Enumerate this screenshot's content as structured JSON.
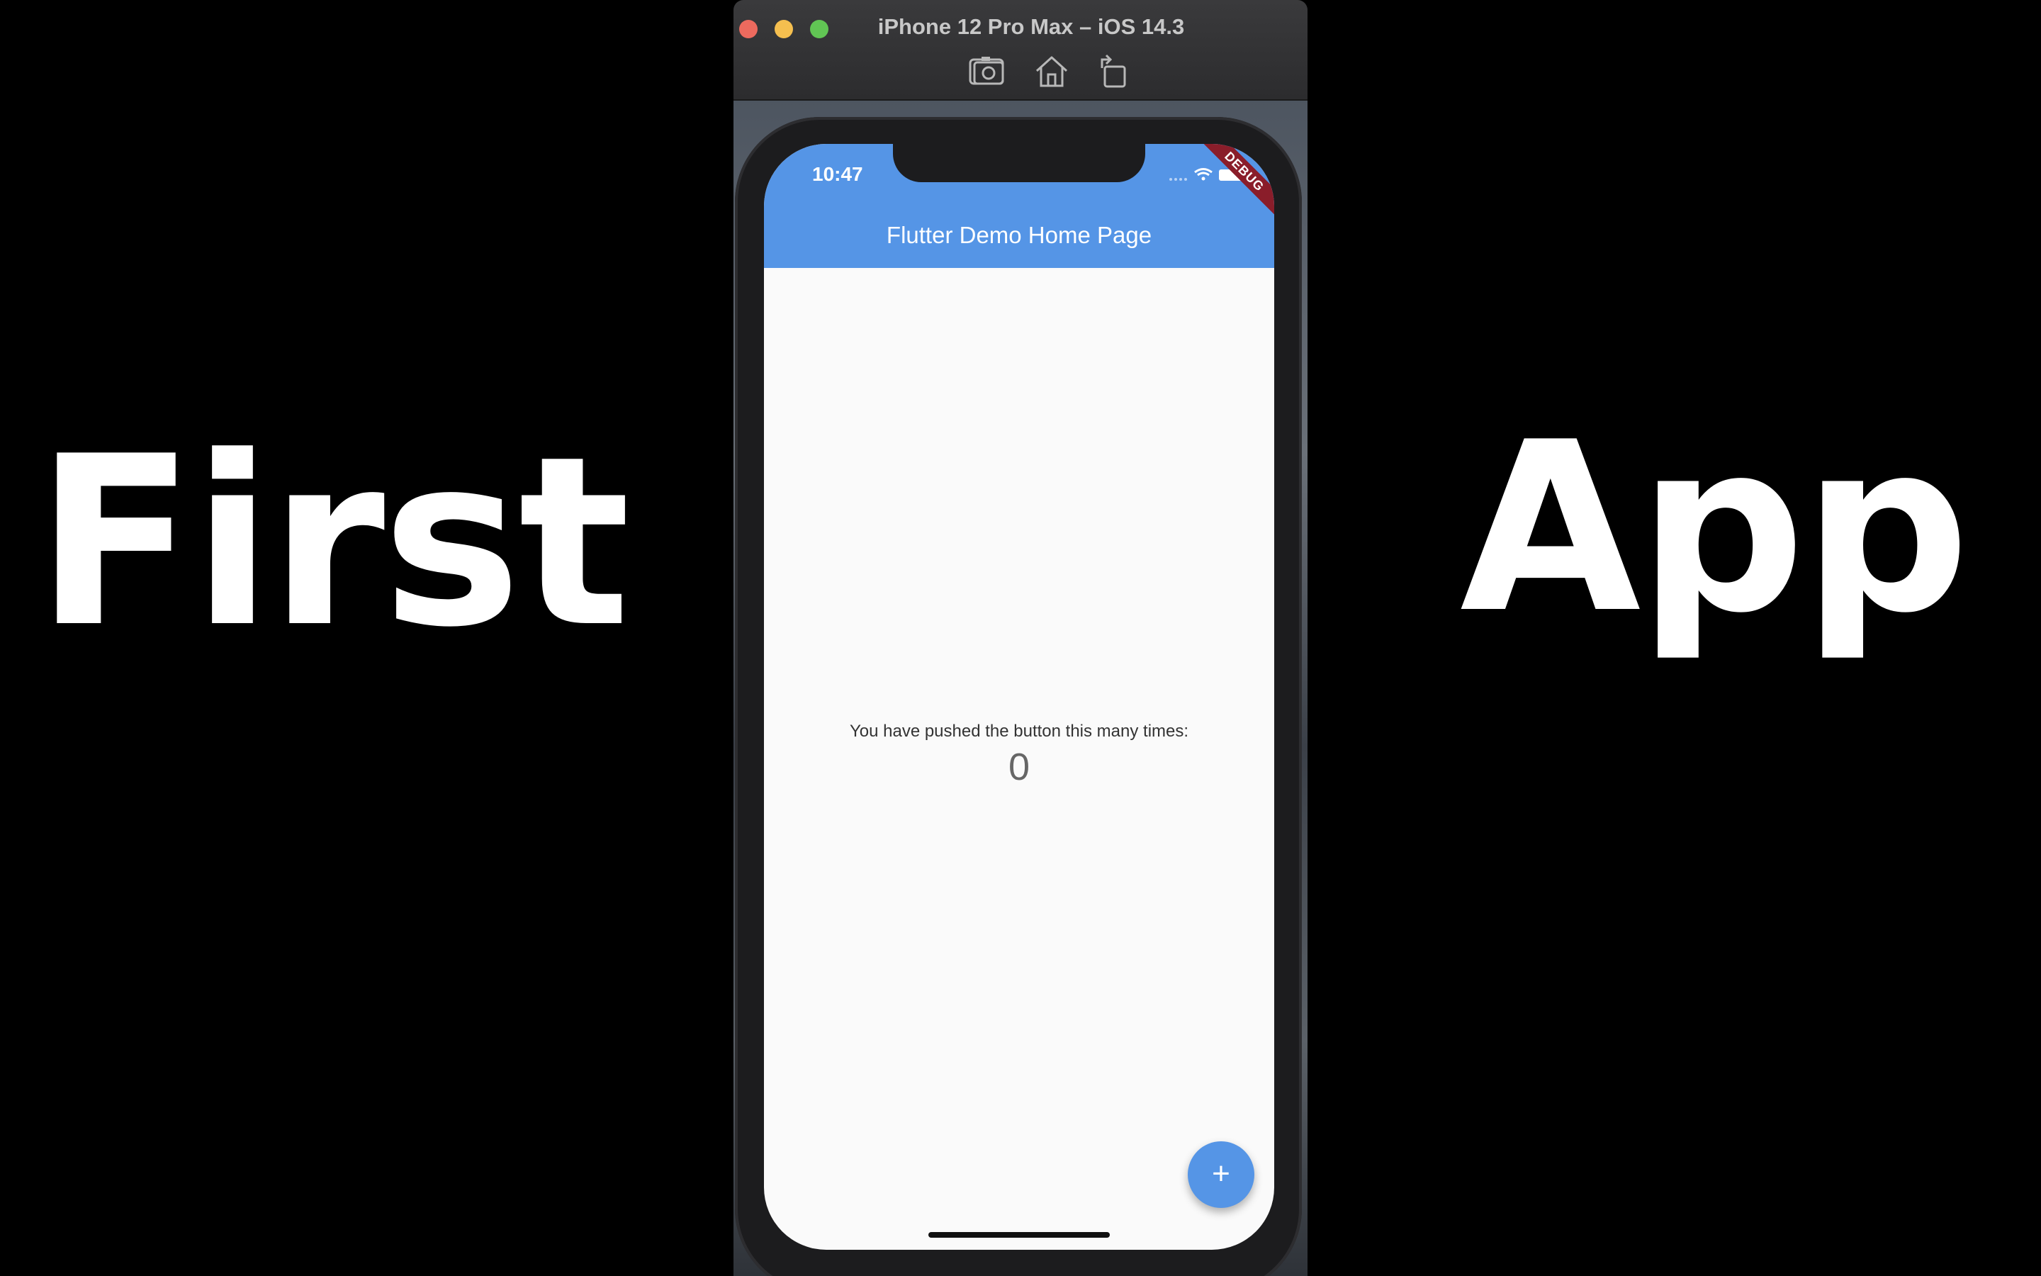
{
  "overlay": {
    "left_word": "First",
    "right_word": "App"
  },
  "simulator": {
    "window_title": "iPhone 12 Pro Max – iOS 14.3",
    "toolbar": {
      "screenshot_icon": "camera-icon",
      "home_icon": "home-icon",
      "rotate_icon": "rotate-icon"
    }
  },
  "status_bar": {
    "time": "10:47",
    "icons": [
      "signal-icon",
      "wifi-icon",
      "battery-icon"
    ]
  },
  "app": {
    "title": "Flutter Demo Home Page",
    "debug_banner": "DEBUG",
    "counter_label": "You have pushed the button this many times:",
    "counter_value": "0",
    "fab_label": "+",
    "accent_color": "#5595e6"
  }
}
